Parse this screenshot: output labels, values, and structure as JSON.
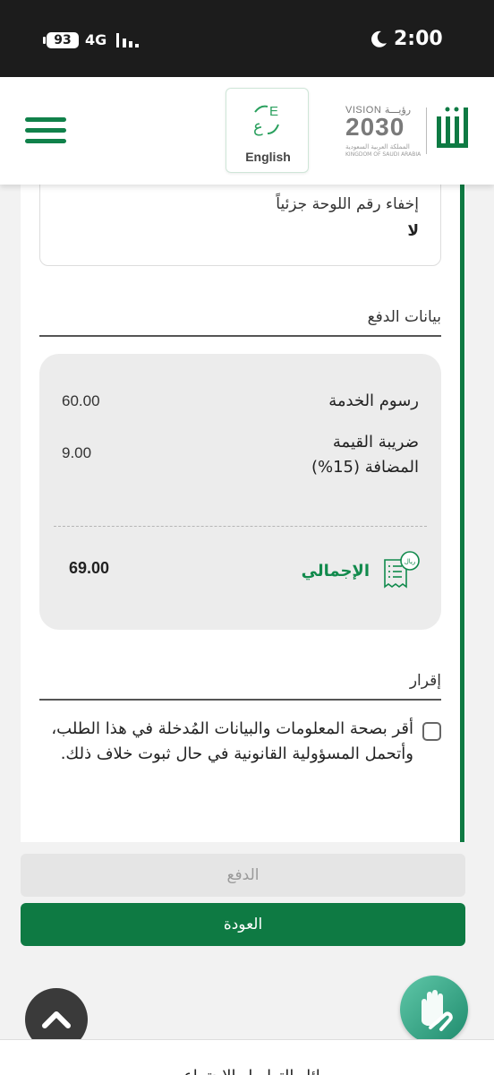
{
  "status_bar": {
    "battery": "93",
    "network": "4G",
    "time": "2:00"
  },
  "header": {
    "language_label": "English",
    "vision_top": "VISION رؤيـــة",
    "vision_number": "2030",
    "vision_ar": "المملكة العربية السعودية",
    "vision_en": "KINGDOM OF SAUDI ARABIA"
  },
  "plate": {
    "title": "إخفاء رقم اللوحة جزئياً",
    "value": "لا"
  },
  "payment": {
    "section_title": "بيانات الدفع",
    "service_fee_label": "رسوم الخدمة",
    "service_fee_value": "60.00",
    "vat_label_line1": "ضريبة القيمة",
    "vat_label_line2": "المضافة (15%)",
    "vat_value": "9.00",
    "total_label": "الإجمالي",
    "total_value": "69.00",
    "currency_icon_text": "ريال"
  },
  "declaration": {
    "section_title": "إقرار",
    "text": "أقر بصحة المعلومات والبيانات المُدخلة في هذا الطلب، وأتحمل المسؤولية القانونية في حال ثبوت خلاف ذلك.",
    "checked": false
  },
  "buttons": {
    "pay_label": "الدفع",
    "back_label": "العودة"
  },
  "footer": {
    "partial_text": "وسائل التواصل الاجتماعي"
  },
  "colors": {
    "brand_green": "#0e7a43",
    "total_green": "#118a4c",
    "status_bar": "#1c1c1c"
  }
}
